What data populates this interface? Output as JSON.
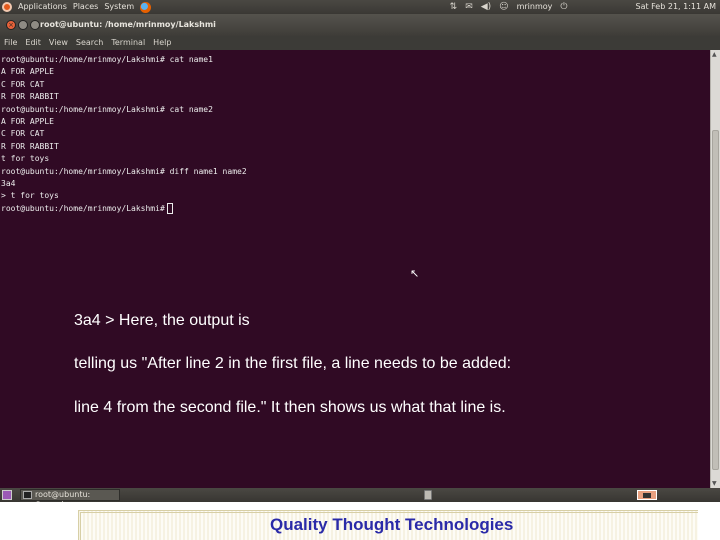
{
  "top_panel": {
    "menus": [
      "Applications",
      "Places",
      "System"
    ],
    "user": "mrinmoy",
    "clock": "Sat Feb 21, 1:11 AM"
  },
  "window": {
    "title": "root@ubuntu: /home/mrinmoy/Lakshmi"
  },
  "menu_bar": [
    "File",
    "Edit",
    "View",
    "Search",
    "Terminal",
    "Help"
  ],
  "terminal": {
    "lines": [
      "root@ubuntu:/home/mrinmoy/Lakshmi# cat name1",
      "A FOR APPLE",
      "C FOR CAT",
      "R FOR RABBIT",
      "root@ubuntu:/home/mrinmoy/Lakshmi# cat name2",
      "A FOR APPLE",
      "C FOR CAT",
      "R FOR RABBIT",
      "t for toys",
      "root@ubuntu:/home/mrinmoy/Lakshmi# diff name1 name2",
      "3a4",
      "> t for toys"
    ],
    "prompt": "root@ubuntu:/home/mrinmoy/Lakshmi#"
  },
  "annotation": {
    "line1": "3a4 >  Here, the output is",
    "line2": "telling us \"After line 2 in the first file, a line needs to be added:",
    "line3": "line 4 from the second file.\" It then shows us what that line is."
  },
  "taskbar": {
    "window_button": "root@ubuntu: /home/..."
  },
  "footer": {
    "text": "Quality Thought Technologies"
  },
  "colors": {
    "terminal_bg": "#300a24",
    "footer_text": "#2a2aa8"
  }
}
